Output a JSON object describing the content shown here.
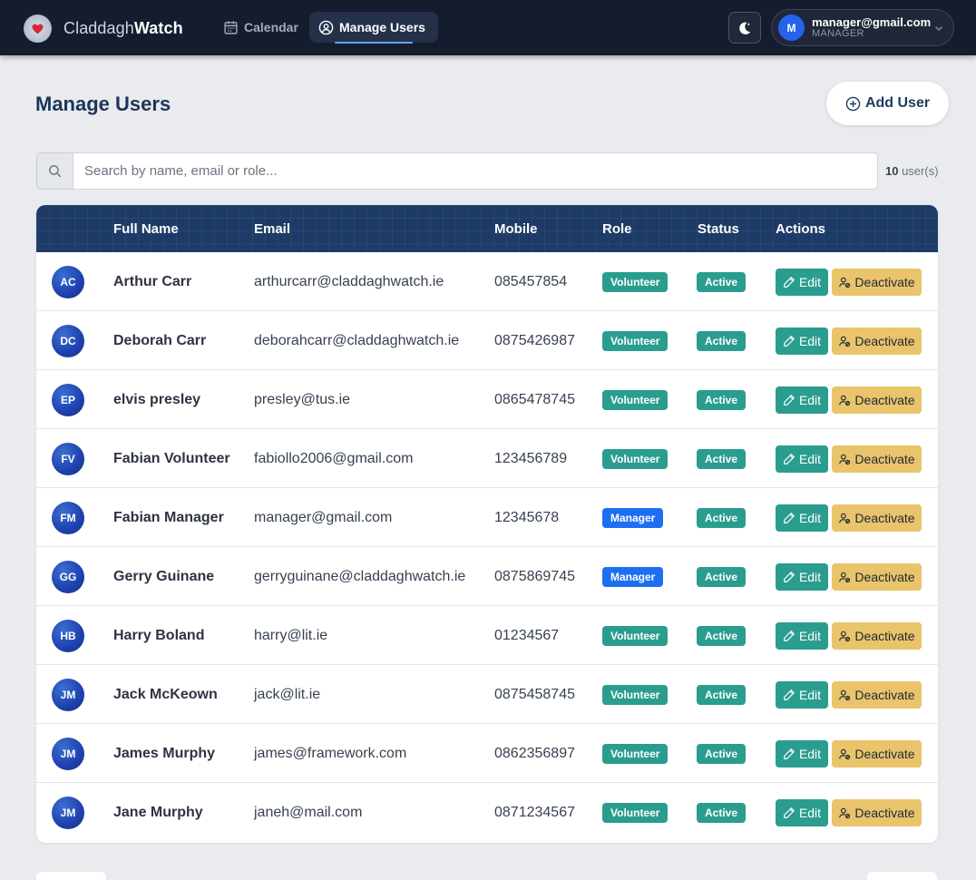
{
  "brand": {
    "name_light": "Claddagh",
    "name_bold": "Watch"
  },
  "nav": {
    "calendar": "Calendar",
    "manage_users": "Manage Users"
  },
  "user_menu": {
    "avatar_initial": "M",
    "email": "manager@gmail.com",
    "role": "MANAGER"
  },
  "page": {
    "title": "Manage Users",
    "add_user_label": "Add User"
  },
  "search": {
    "placeholder": "Search by name, email or role...",
    "value": "",
    "count": "10",
    "count_suffix": " user(s)"
  },
  "table": {
    "headers": {
      "full_name": "Full Name",
      "email": "Email",
      "mobile": "Mobile",
      "role": "Role",
      "status": "Status",
      "actions": "Actions"
    },
    "edit_label": "Edit",
    "deactivate_label": "Deactivate",
    "rows": [
      {
        "initials": "AC",
        "name": "Arthur Carr",
        "email": "arthurcarr@claddaghwatch.ie",
        "mobile": "085457854",
        "role": "Volunteer",
        "status": "Active"
      },
      {
        "initials": "DC",
        "name": "Deborah Carr",
        "email": "deborahcarr@claddaghwatch.ie",
        "mobile": "0875426987",
        "role": "Volunteer",
        "status": "Active"
      },
      {
        "initials": "EP",
        "name": "elvis presley",
        "email": "presley@tus.ie",
        "mobile": "0865478745",
        "role": "Volunteer",
        "status": "Active"
      },
      {
        "initials": "FV",
        "name": "Fabian Volunteer",
        "email": "fabiollo2006@gmail.com",
        "mobile": "123456789",
        "role": "Volunteer",
        "status": "Active"
      },
      {
        "initials": "FM",
        "name": "Fabian Manager",
        "email": "manager@gmail.com",
        "mobile": "12345678",
        "role": "Manager",
        "status": "Active"
      },
      {
        "initials": "GG",
        "name": "Gerry Guinane",
        "email": "gerryguinane@claddaghwatch.ie",
        "mobile": "0875869745",
        "role": "Manager",
        "status": "Active"
      },
      {
        "initials": "HB",
        "name": "Harry Boland",
        "email": "harry@lit.ie",
        "mobile": "01234567",
        "role": "Volunteer",
        "status": "Active"
      },
      {
        "initials": "JM",
        "name": "Jack McKeown",
        "email": "jack@lit.ie",
        "mobile": "0875458745",
        "role": "Volunteer",
        "status": "Active"
      },
      {
        "initials": "JM",
        "name": "James Murphy",
        "email": "james@framework.com",
        "mobile": "0862356897",
        "role": "Volunteer",
        "status": "Active"
      },
      {
        "initials": "JM",
        "name": "Jane Murphy",
        "email": "janeh@mail.com",
        "mobile": "0871234567",
        "role": "Volunteer",
        "status": "Active"
      }
    ]
  },
  "colors": {
    "navbar_bg": "#151c2e",
    "table_header_bg": "#1e3a66",
    "volunteer_badge": "#2a9d8f",
    "manager_badge": "#1d6ff2",
    "active_badge": "#2a9d8f",
    "edit_button": "#2a9d8f",
    "deactivate_button": "#e9c46a"
  },
  "icons": {
    "logo": "claddagh-heart-logo",
    "calendar": "calendar-icon",
    "manage_users": "user-circle-icon",
    "theme_toggle": "moon-stars-icon",
    "chevron": "chevron-down-icon",
    "add_user": "plus-circle-icon",
    "search": "search-icon",
    "edit": "pencil-icon",
    "deactivate": "user-slash-icon"
  }
}
